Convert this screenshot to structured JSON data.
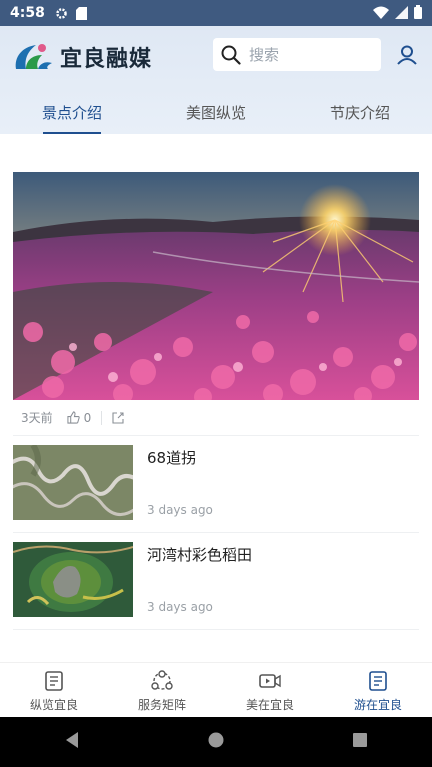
{
  "status_bar": {
    "time": "4:58"
  },
  "header": {
    "logo_text": "宜良融媒",
    "search_placeholder": "搜索",
    "tabs": [
      {
        "label": "景点介绍",
        "active": true
      },
      {
        "label": "美图纵览",
        "active": false
      },
      {
        "label": "节庆介绍",
        "active": false
      }
    ]
  },
  "featured": {
    "time": "3天前",
    "likes": "0"
  },
  "articles": [
    {
      "title": "68道拐",
      "time": "3 days ago"
    },
    {
      "title": "河湾村彩色稻田",
      "time": "3 days ago"
    }
  ],
  "bottom_nav": [
    {
      "label": "纵览宜良",
      "icon": "newspaper-icon",
      "active": false
    },
    {
      "label": "服务矩阵",
      "icon": "network-icon",
      "active": false
    },
    {
      "label": "美在宜良",
      "icon": "video-icon",
      "active": false
    },
    {
      "label": "游在宜良",
      "icon": "newspaper-icon",
      "active": true
    }
  ],
  "colors": {
    "accent": "#1f4f8f",
    "status_bar": "#3f5a80"
  }
}
